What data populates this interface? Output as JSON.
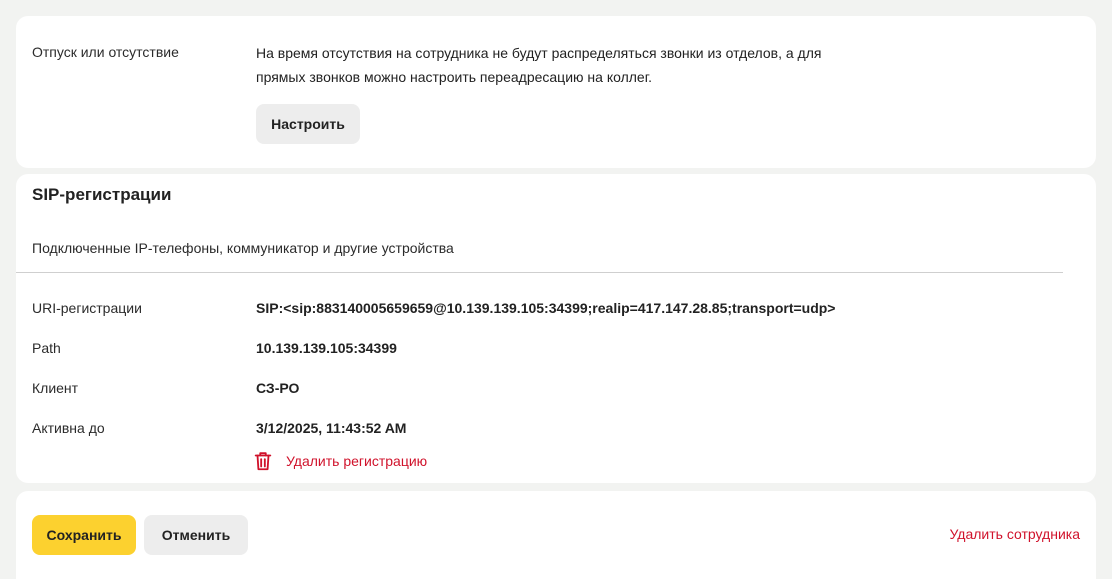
{
  "vacation": {
    "label": "Отпуск или отсутствие",
    "description_line1": "На время отсутствия на сотрудника не будут распределяться звонки из отделов, а для",
    "description_line2": "прямых звонков можно настроить переадресацию на коллег.",
    "configure_button": "Настроить"
  },
  "sip": {
    "title": "SIP-регистрации",
    "subtitle": "Подключенные IP-телефоны, коммуникатор и другие устройства",
    "rows": [
      {
        "label": "URI-регистрации",
        "value": "SIP:<sip:883140005659659@10.139.139.105:34399;realip=417.147.28.85;transport=udp>"
      },
      {
        "label": "Path",
        "value": "10.139.139.105:34399"
      },
      {
        "label": "Клиент",
        "value": "СЗ-РО"
      },
      {
        "label": "Активна до",
        "value": "3/12/2025, 11:43:52 AM"
      }
    ],
    "delete_registration": "Удалить регистрацию",
    "delete_icon": "trash-icon"
  },
  "actions": {
    "save": "Сохранить",
    "cancel": "Отменить",
    "delete_employee": "Удалить сотрудника"
  },
  "colors": {
    "accent_yellow": "#fcd12f",
    "danger_red": "#d0122b",
    "background": "#f2f3f1"
  }
}
